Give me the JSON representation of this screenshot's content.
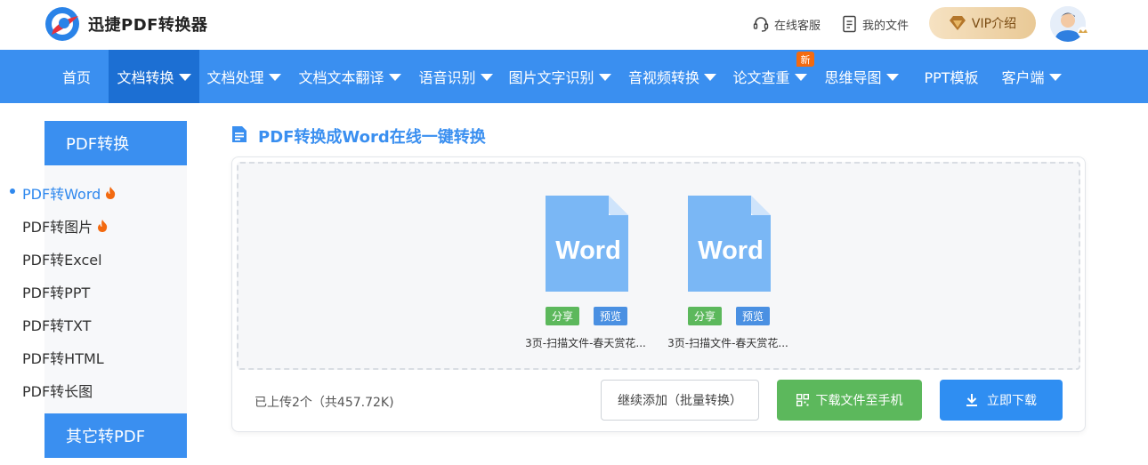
{
  "header": {
    "brand": "迅捷PDF转换器",
    "support_label": "在线客服",
    "files_label": "我的文件",
    "vip_label": "VIP介绍"
  },
  "nav": {
    "items": [
      {
        "label": "首页",
        "dropdown": false
      },
      {
        "label": "文档转换",
        "dropdown": true,
        "active": true
      },
      {
        "label": "文档处理",
        "dropdown": true
      },
      {
        "label": "文档文本翻译",
        "dropdown": true
      },
      {
        "label": "语音识别",
        "dropdown": true
      },
      {
        "label": "图片文字识别",
        "dropdown": true
      },
      {
        "label": "音视频转换",
        "dropdown": true
      },
      {
        "label": "论文查重",
        "dropdown": true
      },
      {
        "label": "思维导图",
        "dropdown": true
      },
      {
        "label": "PPT模板",
        "dropdown": false
      },
      {
        "label": "客户端",
        "dropdown": true
      }
    ],
    "new_badge": "新"
  },
  "sidebar": {
    "section1_title": "PDF转换",
    "items": [
      {
        "label": "PDF转Word",
        "hot": true,
        "active": true
      },
      {
        "label": "PDF转图片",
        "hot": true
      },
      {
        "label": "PDF转Excel"
      },
      {
        "label": "PDF转PPT"
      },
      {
        "label": "PDF转TXT"
      },
      {
        "label": "PDF转HTML"
      },
      {
        "label": "PDF转长图"
      }
    ],
    "section2_title": "其它转PDF"
  },
  "main": {
    "title": "PDF转换成Word在线一键转换",
    "files": [
      {
        "icon_text": "Word",
        "share_label": "分享",
        "preview_label": "预览",
        "name": "3页-扫描文件-春天赏花..."
      },
      {
        "icon_text": "Word",
        "share_label": "分享",
        "preview_label": "预览",
        "name": "3页-扫描文件-春天赏花..."
      }
    ],
    "upload_info": "已上传2个（共457.72K)",
    "add_label": "继续添加（批量转换）",
    "phone_label": "下载文件至手机",
    "download_label": "立即下载"
  },
  "colors": {
    "nav_bg": "#3a8ff0",
    "nav_active": "#1c6fd3",
    "file_icon": "#7ab7f5",
    "share_green": "#5cb85c",
    "download_blue": "#2f8ef2",
    "hot_orange": "#f36a10"
  }
}
